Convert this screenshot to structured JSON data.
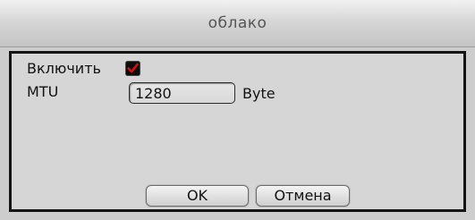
{
  "dialog": {
    "title": "облако",
    "enable_label": "Включить",
    "enable_checked": true,
    "mtu_label": "MTU",
    "mtu_value": "1280",
    "mtu_unit": "Byte",
    "ok_label": "OK",
    "cancel_label": "Отмена"
  },
  "colors": {
    "checkbox_bg": "#0d0d0d",
    "checkmark": "#d01010",
    "panel_border": "#141414"
  },
  "icons": {
    "check": "checkmark-icon"
  }
}
